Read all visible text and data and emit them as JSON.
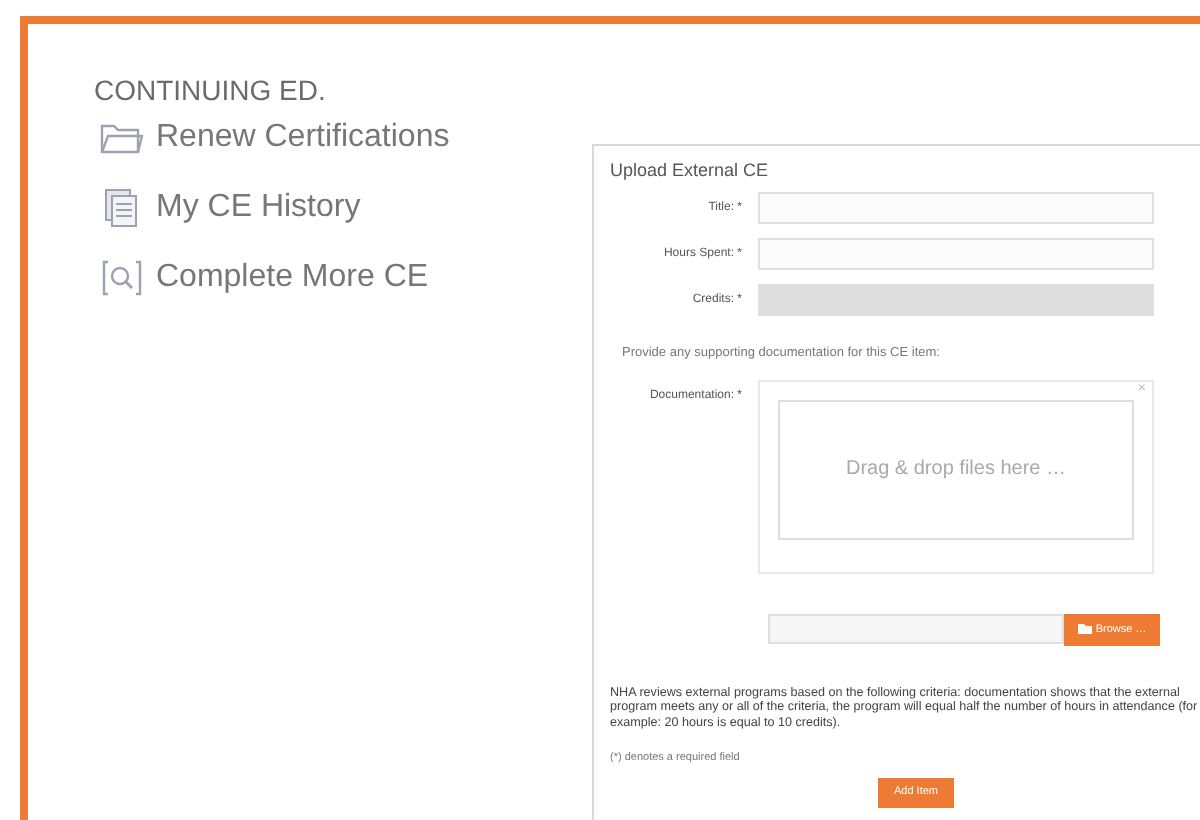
{
  "sidebar": {
    "heading": "CONTINUING ED.",
    "items": [
      {
        "label": "Renew Certifications",
        "kind": "folder"
      },
      {
        "label": "My CE History",
        "kind": "history"
      },
      {
        "label": "Complete More CE",
        "kind": "search"
      }
    ]
  },
  "form": {
    "title": "Upload External CE",
    "fields": [
      {
        "label": "Title: *",
        "disabled": false
      },
      {
        "label": "Hours Spent: *",
        "disabled": false
      },
      {
        "label": "Credits: *",
        "disabled": true
      }
    ],
    "prompt": "Provide any supporting documentation for this CE item:",
    "documentation": {
      "label": "Documentation: *",
      "dropzone": "Drag & drop files here …",
      "close": "×",
      "browse": "Browse …"
    },
    "note": "NHA reviews external programs based on the following criteria: documentation shows that the external program meets any or all of the criteria, the program will equal half the number of hours in attendance (for example: 20 hours is equal to 10 credits).",
    "required_note": "(*) denotes a required field",
    "submit": "Add Item"
  }
}
